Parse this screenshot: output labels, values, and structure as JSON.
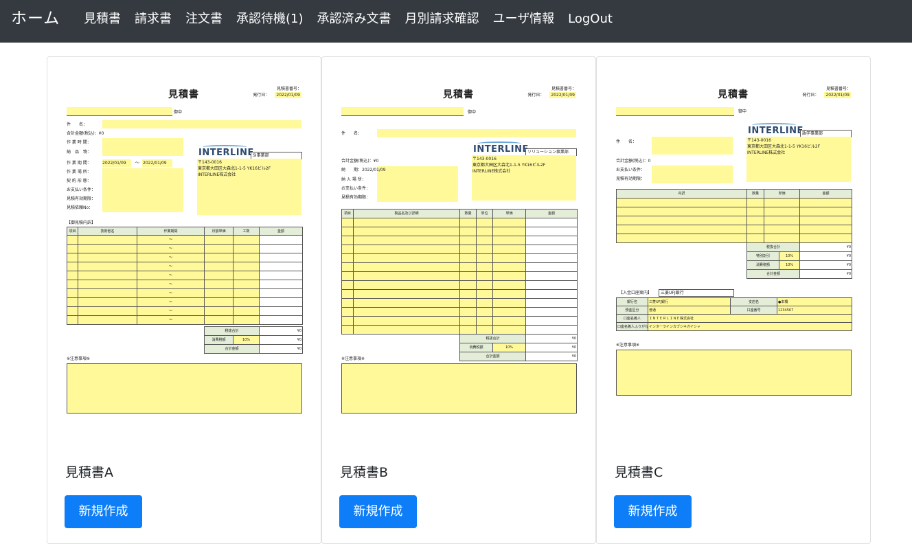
{
  "navbar": {
    "brand": "ホーム",
    "links": [
      "見積書",
      "請求書",
      "注文書",
      "承認待機(1)",
      "承認済み文書",
      "月別請求確認",
      "ユーザ情報",
      "LogOut"
    ]
  },
  "cards": [
    {
      "title": "見積書A",
      "button": "新規作成",
      "doc": {
        "heading": "見積書",
        "number_label": "見積書番号：",
        "date_label": "発行日：",
        "date": "2022/01/09",
        "honorific": "御中",
        "logo": "INTERLINE",
        "dept": "SI事業部",
        "postal": "〒143-0016",
        "address": "東京都大田区大森北1-1-5 YK16ビル2F",
        "company": "INTERLINE株式会社",
        "fields": [
          "件　　名：",
          "合計金額(税込)：¥0",
          "作 業 時 間：",
          "納　品　物：",
          "作 業 期 間：",
          "作 業 場 所：",
          "契 約 形 態：",
          "お支払い条件：",
          "見積有効期限：",
          "見積依頼No："
        ],
        "period_start": "2022/01/09",
        "period_sep": "〜",
        "period_end": "2022/01/09",
        "section": "【御見積内訳】",
        "columns": [
          "項目",
          "技術者名",
          "作業期間",
          "月額単価",
          "工数",
          "金額"
        ],
        "tilde": "〜",
        "summary": [
          "税抜合計",
          "消費税額",
          "合計金額"
        ],
        "tax_rate": "10%",
        "yen": "¥0",
        "notes": "※注意事項※"
      }
    },
    {
      "title": "見積書B",
      "button": "新規作成",
      "doc": {
        "heading": "見積書",
        "number_label": "見積書番号：",
        "date_label": "発行日：",
        "date": "2022/01/09",
        "honorific": "御中",
        "logo": "INTERLINE",
        "dept": "ソリューション事業部",
        "postal": "〒143-0016",
        "address": "東京都大田区大森北1-1-5 YK16ビル2F",
        "company": "INTERLINE株式会社",
        "fields": [
          "件　　名：",
          "合計金額(税込)：¥0",
          "納　　期：2022/01/09",
          "納 入 場 所：",
          "お支払い条件：",
          "見積有効期限："
        ],
        "columns": [
          "項目",
          "製品名及び詳細",
          "数量",
          "単位",
          "単価",
          "金額"
        ],
        "summary": [
          "税抜合計",
          "消費税額",
          "合計金額"
        ],
        "tax_rate": "10%",
        "yen": "¥0",
        "notes": "※注意事項※"
      }
    },
    {
      "title": "見積書C",
      "button": "新規作成",
      "doc": {
        "heading": "見積書",
        "number_label": "見積書番号：",
        "date_label": "発行日：",
        "date": "2022/01/09",
        "honorific": "御中",
        "logo": "INTERLINE",
        "dept": "語学事業部",
        "postal": "〒143-0016",
        "address": "東京都大田区大森北1-1-5 YK16ビル2F",
        "company": "INTERLINE株式会社",
        "fields": [
          "件　　名：",
          "合計金額(税込)：0",
          "お支払い条件：",
          "見積有効期限："
        ],
        "columns": [
          "内訳",
          "数量",
          "単価",
          "金額"
        ],
        "summary": [
          "税抜合計",
          "特別割引",
          "消費税額",
          "合計金額"
        ],
        "tax_rate": "10%",
        "yen": "¥0",
        "bank_heading": "【入金口座案内】",
        "bank_name_top": "三菱UFJ銀行",
        "bank_rows": [
          [
            "銀行名",
            "三菱UFJ銀行",
            "支店名",
            "●本橋"
          ],
          [
            "預金区分",
            "普通",
            "口座番号",
            "1234567"
          ],
          [
            "口座名義人",
            "ＩＮＴＥＲＬＩＮＥ株式会社"
          ],
          [
            "口座名義人ふりがな",
            "インターラインカブシキガイシャ"
          ]
        ],
        "notes": "※注意事項※"
      }
    }
  ]
}
